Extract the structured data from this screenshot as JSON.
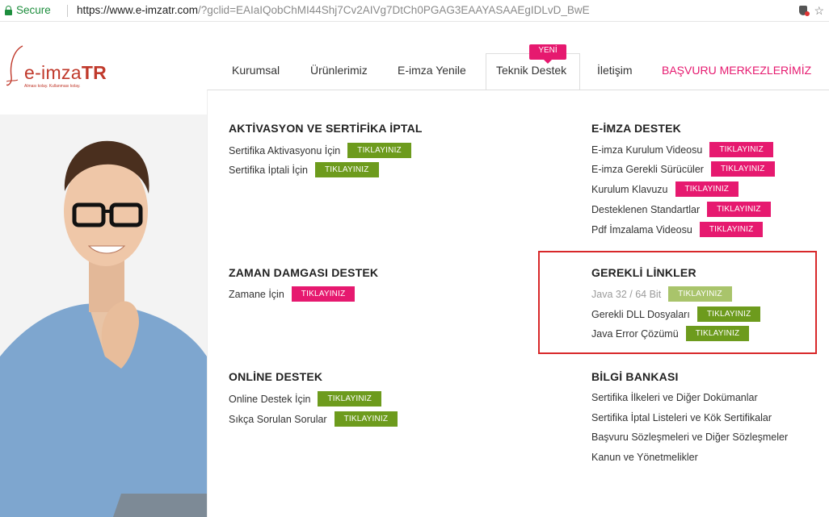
{
  "address_bar": {
    "secure_label": "Secure",
    "url_base": "https://www.e-imzatr.com",
    "url_rest": "/?gclid=EAIaIQobChMI44Shj7Cv2AIVg7DtCh0PGAG3EAAYASAAEgIDLvD_BwE"
  },
  "logo": {
    "text_light": "e-imza",
    "text_bold": "TR",
    "tagline": "Alması kolay. Kullanması kolay."
  },
  "nav": {
    "items": [
      "Kurumsal",
      "Ürünlerimiz",
      "E-imza Yenile",
      "Teknik Destek",
      "İletişim",
      "BAŞVURU MERKEZLERİMİZ"
    ],
    "badge": "YENİ"
  },
  "colors": {
    "green": "#6d9b1d",
    "pink": "#e6196f",
    "highlight_box": "#d8282a"
  },
  "sections": {
    "aktivasyon": {
      "title": "AKTİVASYON VE SERTİFİKA İPTAL",
      "items": [
        {
          "label": "Sertifika Aktivasyonu İçin",
          "button": "TIKLAYINIZ"
        },
        {
          "label": "Sertifika İptali İçin",
          "button": "TIKLAYINIZ"
        }
      ]
    },
    "eimza": {
      "title": "E-İMZA DESTEK",
      "items": [
        {
          "label": "E-imza Kurulum Videosu",
          "button": "TIKLAYINIZ"
        },
        {
          "label": "E-imza Gerekli Sürücüler",
          "button": "TIKLAYINIZ"
        },
        {
          "label": "Kurulum Klavuzu",
          "button": "TIKLAYINIZ"
        },
        {
          "label": "Desteklenen Standartlar",
          "button": "TIKLAYINIZ"
        },
        {
          "label": "Pdf İmzalama Videosu",
          "button": "TIKLAYINIZ"
        }
      ]
    },
    "zaman": {
      "title": "ZAMAN DAMGASI DESTEK",
      "items": [
        {
          "label": "Zamane İçin",
          "button": "TIKLAYINIZ"
        }
      ]
    },
    "gerekli": {
      "title": "GEREKLİ LİNKLER",
      "items": [
        {
          "label": "Java 32 / 64 Bit",
          "button": "TIKLAYINIZ"
        },
        {
          "label": "Gerekli DLL Dosyaları",
          "button": "TIKLAYINIZ"
        },
        {
          "label": "Java Error Çözümü",
          "button": "TIKLAYINIZ"
        }
      ]
    },
    "online": {
      "title": "ONLİNE DESTEK",
      "items": [
        {
          "label": "Online Destek İçin",
          "button": "TIKLAYINIZ"
        },
        {
          "label": "Sıkça Sorulan Sorular",
          "button": "TIKLAYINIZ"
        }
      ]
    },
    "bilgi": {
      "title": "BİLGİ BANKASI",
      "links": [
        "Sertifika İlkeleri ve Diğer Dokümanlar",
        "Sertifika İptal Listeleri ve Kök Sertifikalar",
        "Başvuru Sözleşmeleri ve Diğer Sözleşmeler",
        "Kanun ve Yönetmelikler"
      ]
    }
  }
}
